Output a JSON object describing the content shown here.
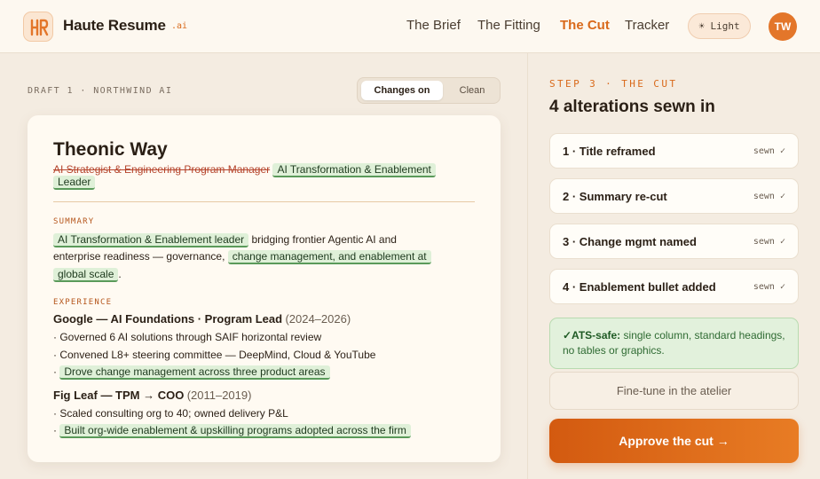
{
  "header": {
    "brand": "Haute Resume",
    "brand_suffix": ".ai",
    "nav": [
      {
        "label": "The Brief",
        "active": false
      },
      {
        "label": "The Fitting",
        "active": false
      },
      {
        "label": "The Cut",
        "active": true
      },
      {
        "label": "Tracker",
        "active": false
      }
    ],
    "theme_toggle": "☀ Light",
    "avatar_initials": "TW",
    "accent_color": "#d9691a"
  },
  "draft": {
    "label": "DRAFT 1 · NORTHWIND AI",
    "toggle": {
      "changes_on": "Changes on",
      "clean": "Clean",
      "selected": "Changes on"
    }
  },
  "resume": {
    "name": "Theonic Way",
    "old_title": "AI Strategist & Engineering Program Manager",
    "new_title_line1": "AI Transformation & Enablement",
    "new_title_line2": "Leader",
    "summary_heading": "SUMMARY",
    "summary": {
      "hl1": "AI Transformation & Enablement leader",
      "text1": "bridging frontier Agentic AI and",
      "text2": "enterprise readiness — governance,",
      "hl2a": "change management, and enablement at",
      "hl2b": "global scale",
      "end": "."
    },
    "experience_heading": "EXPERIENCE",
    "jobs": [
      {
        "title": "Google — AI Foundations · Program Lead",
        "years": "(2024–2026)",
        "bullets": [
          {
            "text": "· Governed 6 AI solutions through SAIF horizontal review",
            "added": false
          },
          {
            "text": "· Convened L8+ steering committee — DeepMind, Cloud & YouTube",
            "added": false
          },
          {
            "text": "Drove change management across three product areas",
            "added": true
          }
        ]
      },
      {
        "title": "Fig Leaf — TPM → COO",
        "years": "(2011–2019)",
        "bullets": [
          {
            "text": "· Scaled consulting org to 40; owned delivery P&L",
            "added": false
          },
          {
            "text": "Built org-wide enablement & upskilling programs adopted across the firm",
            "added": true
          }
        ]
      }
    ],
    "bullet_dot": "·"
  },
  "panel": {
    "step_label": "STEP 3 · THE CUT",
    "title": "4 alterations sewn in",
    "alterations": [
      {
        "title": "1 · Title reframed",
        "status": "sewn ✓"
      },
      {
        "title": "2 · Summary re-cut",
        "status": "sewn ✓"
      },
      {
        "title": "3 · Change mgmt named",
        "status": "sewn ✓"
      },
      {
        "title": "4 · Enablement bullet added",
        "status": "sewn ✓"
      }
    ],
    "ats_label": "✓ATS-safe:",
    "ats_text": " single column, standard headings, no tables or graphics.",
    "finetune_label": "Fine-tune in the atelier",
    "approve_label": "Approve the cut →"
  }
}
